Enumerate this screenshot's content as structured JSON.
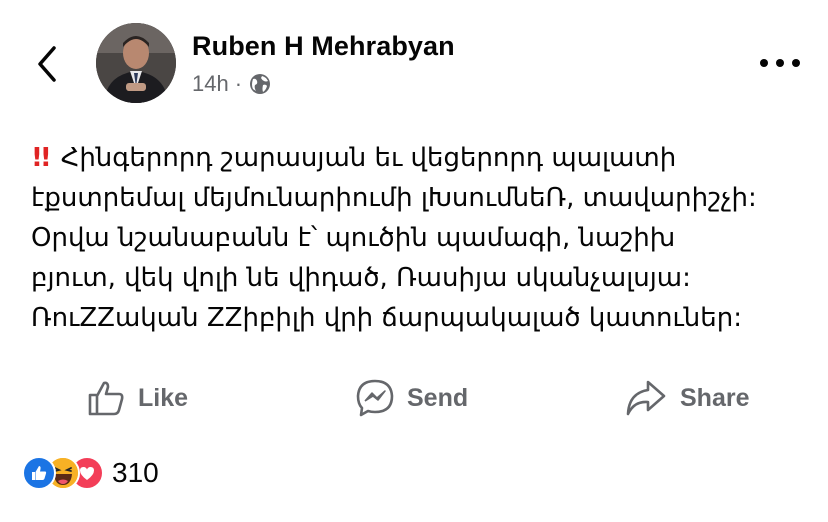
{
  "post": {
    "author": "Ruben H Mehrabyan",
    "time": "14h",
    "dot": "·",
    "alert_icon": "double-exclamation-icon",
    "lines": [
      "Հինգերորդ շարասյան եւ վեցերորդ պալատի",
      "էքստրեմալ մեյմունարիումի լԽսումնեՌ, տավարիշչի:",
      "Օրվա նշանաբանն է՝ պուծին պամագի, նաշիխ",
      "բյուտ, վեկ վոլի նե վիդած, Ռասիյա սկանչալսյա:",
      "ՌուZZական ZZիբիլի վրի ճարպակալած կատուներ:"
    ]
  },
  "actions": {
    "like": "Like",
    "send": "Send",
    "share": "Share"
  },
  "reactions": {
    "count": "310",
    "icons": [
      "like-reaction-icon",
      "haha-reaction-icon",
      "love-reaction-icon"
    ],
    "colors": {
      "like": "#1b74e4",
      "haha": "#f7b125",
      "love": "#f33e58"
    }
  },
  "colors": {
    "text": "#050505",
    "secondary": "#65676b",
    "alert": "#e02424"
  }
}
